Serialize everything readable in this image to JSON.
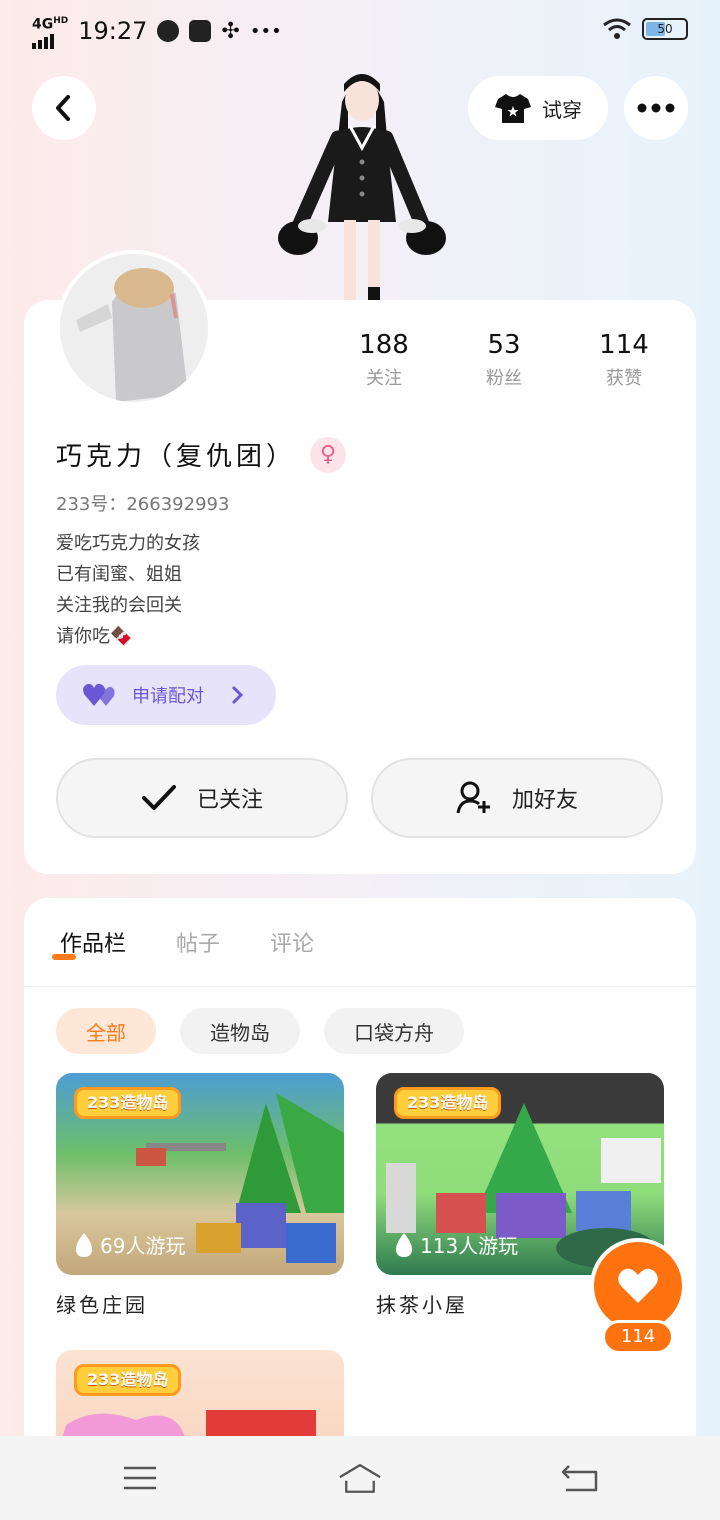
{
  "status_bar": {
    "network": "4G",
    "network_sup": "HD",
    "time": "19:27",
    "more": "•••",
    "battery": "50"
  },
  "header": {
    "try_on_label": "试穿"
  },
  "profile": {
    "stats": [
      {
        "value": "188",
        "label": "关注"
      },
      {
        "value": "53",
        "label": "粉丝"
      },
      {
        "value": "114",
        "label": "获赞"
      }
    ],
    "name": "巧克力（复仇团）",
    "gender_symbol": "♀",
    "account_id": "233号：266392993",
    "bio_lines": [
      "爱吃巧克力的女孩",
      "已有闺蜜、姐姐",
      "关注我的会回关",
      "请你吃🍫"
    ],
    "pair_label": "申请配对",
    "followed_label": "已关注",
    "add_friend_label": "加好友"
  },
  "works": {
    "tabs": [
      "作品栏",
      "帖子",
      "评论"
    ],
    "filters": [
      "全部",
      "造物岛",
      "口袋方舟"
    ],
    "games": [
      {
        "logo": "233造物岛",
        "plays": "69人游玩",
        "title": "绿色庄园"
      },
      {
        "logo": "233造物岛",
        "plays": "113人游玩",
        "title": "抹茶小屋"
      },
      {
        "logo": "233造物岛",
        "plays": "",
        "title": ""
      }
    ]
  },
  "like": {
    "count": "114"
  },
  "colors": {
    "accent": "#ff7210",
    "pair_bg": "#e7e3fb",
    "pair_text": "#6a57d6",
    "gender_bg": "#fde3ea"
  }
}
